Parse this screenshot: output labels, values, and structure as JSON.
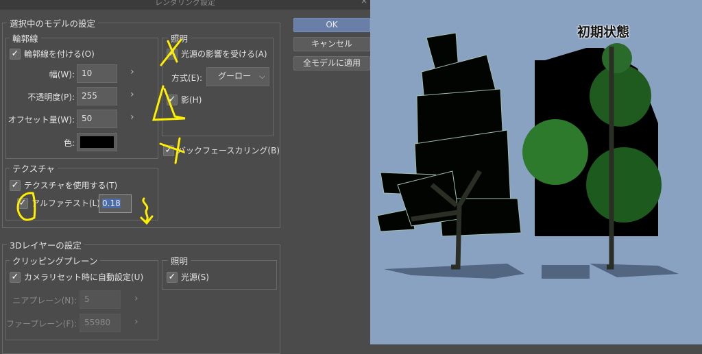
{
  "dialog": {
    "title": "レンダリング設定",
    "close_icon": "×",
    "buttons": {
      "ok": "OK",
      "cancel": "キャンセル",
      "apply_all": "全モデルに適用"
    },
    "model_settings": {
      "legend": "選択中のモデルの設定",
      "outline": {
        "legend": "輪郭線",
        "enable_label": "輪郭線を付ける(O)",
        "enable_checked": true,
        "width_label": "幅(W):",
        "width_value": "10",
        "opacity_label": "不透明度(P):",
        "opacity_value": "255",
        "offset_label": "オフセット量(W):",
        "offset_value": "50",
        "color_label": "色:",
        "color_value": "#000000"
      },
      "lighting": {
        "legend": "照明",
        "light_label": "光源の影響を受ける(A)",
        "light_checked": true,
        "method_label": "方式(E):",
        "method_value": "グーロー",
        "shadow_label": "影(H)",
        "shadow_checked": true
      },
      "backface_label": "バックフェースカリング(B)",
      "backface_checked": true,
      "texture": {
        "legend": "テクスチャ",
        "use_label": "テクスチャを使用する(T)",
        "use_checked": true,
        "alpha_label": "アルファテスト(L)",
        "alpha_checked": true,
        "alpha_value": "0.18"
      }
    },
    "layer_settings": {
      "legend": "3Dレイヤーの設定",
      "clipping": {
        "legend": "クリッピングプレーン",
        "auto_label": "カメラリセット時に自動設定(U)",
        "auto_checked": true,
        "near_label": "ニアプレーン(N):",
        "near_value": "5",
        "far_label": "ファープレーン(F):",
        "far_value": "55980"
      },
      "lighting": {
        "legend": "照明",
        "light_label": "光源(S)",
        "light_checked": true
      }
    },
    "arrow_glyph": "›",
    "check_glyph": "✓"
  },
  "viewport": {
    "caption": "初期状態",
    "background": "#8aa2c2"
  }
}
